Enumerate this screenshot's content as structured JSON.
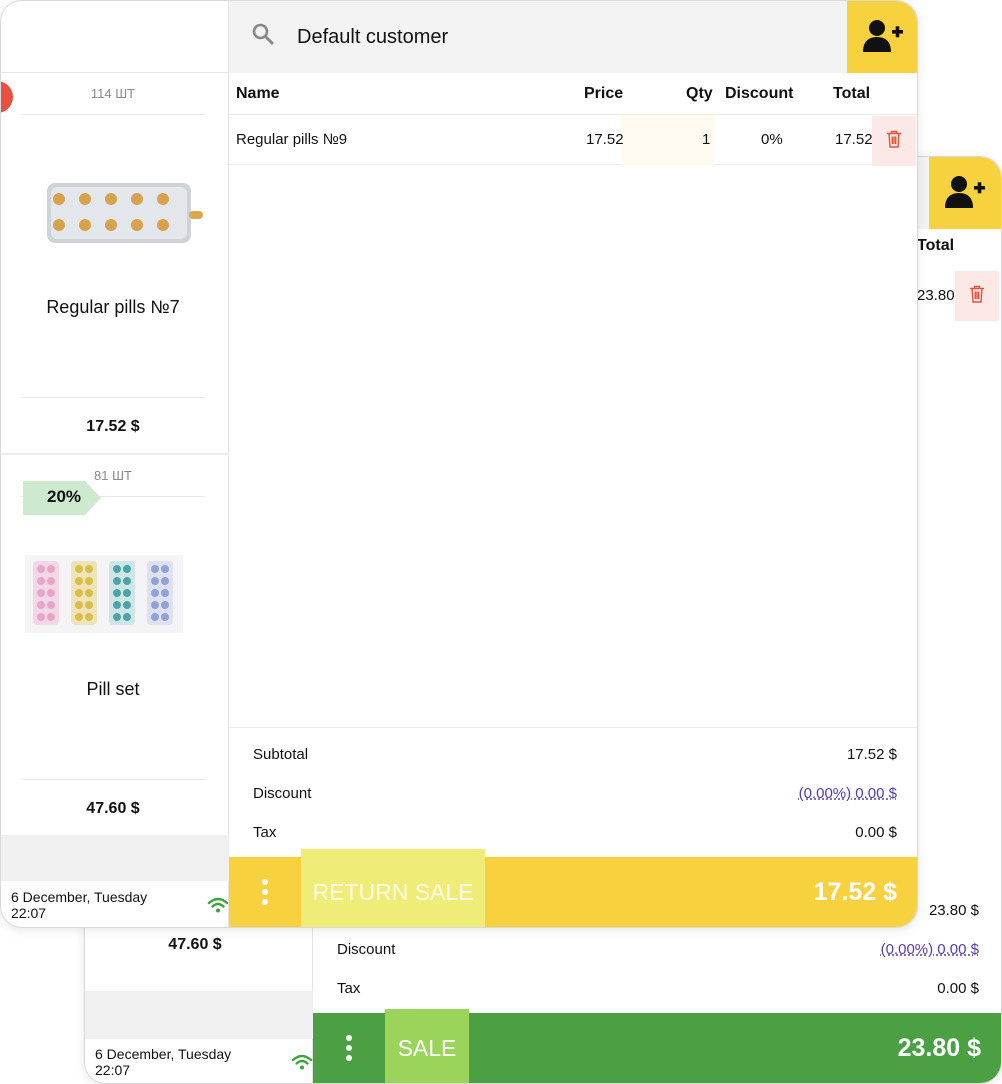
{
  "front": {
    "customer": "Default customer",
    "table_headers": {
      "name": "Name",
      "price": "Price",
      "qty": "Qty",
      "discount": "Discount",
      "total": "Total"
    },
    "cart_items": [
      {
        "name": "Regular pills №9",
        "price": "17.52",
        "qty": "1",
        "discount": "0%",
        "total": "17.52"
      }
    ],
    "products": [
      {
        "stock": "114 ШТ",
        "name": "Regular pills №7",
        "price": "17.52 $"
      },
      {
        "stock": "81 ШТ",
        "name": "Pill set",
        "price": "47.60 $",
        "discount_badge": "20%"
      }
    ],
    "summary": {
      "subtotal_label": "Subtotal",
      "subtotal_value": "17.52 $",
      "discount_label": "Discount",
      "discount_value": "(0.00%) 0.00 $",
      "tax_label": "Tax",
      "tax_value": "0.00 $"
    },
    "action_label": "RETURN SALE",
    "grand_total": "17.52 $",
    "status": "6 December, Tuesday 22:07"
  },
  "back": {
    "total_header": "Total",
    "row_total": "23.80",
    "left_price": "47.60 $",
    "summary": {
      "subtotal_value": "23.80 $",
      "discount_label": "Discount",
      "discount_value": "(0.00%) 0.00 $",
      "tax_label": "Tax",
      "tax_value": "0.00 $"
    },
    "action_label": "SALE",
    "grand_total": "23.80 $",
    "status": "6 December, Tuesday 22:07"
  },
  "icons": {
    "search": "search-icon",
    "add_customer": "add-user-icon",
    "delete": "trash-icon",
    "menu": "more-vertical-icon",
    "wifi": "wifi-icon"
  },
  "colors": {
    "accent_yellow": "#f7d23e",
    "sale_green": "#4aa043",
    "delete_red": "#e0533d",
    "discount_badge": "#cde9cf",
    "wifi_green": "#3aa53a",
    "discount_link": "#5a3aa8"
  }
}
